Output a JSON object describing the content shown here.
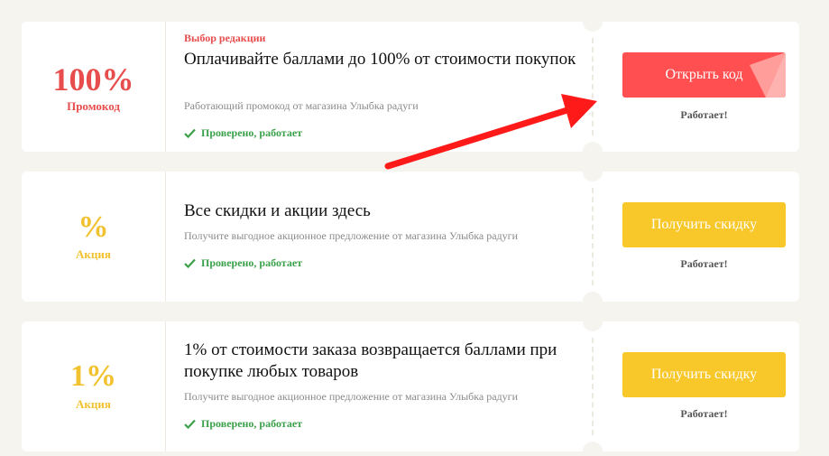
{
  "coupons": [
    {
      "value": "100%",
      "kind": "Промокод",
      "editor_label": "Выбор редакции",
      "title": "Оплачивайте баллами до 100% от стоимости покупок",
      "description": "Работающий промокод от магазина Улыбка радуги",
      "verified": "Проверено, работает",
      "button": "Открыть код",
      "status": "Работает!"
    },
    {
      "value": "%",
      "kind": "Акция",
      "title": "Все скидки и акции здесь",
      "description": "Получите выгодное акционное предложение от магазина Улыбка радуги",
      "verified": "Проверено, работает",
      "button": "Получить скидку",
      "status": "Работает!"
    },
    {
      "value": "1%",
      "kind": "Акция",
      "title": "1% от стоимости заказа возвращается баллами при покупке любых товаров",
      "description": "Получите выгодное акционное предложение от магазина Улыбка радуги",
      "verified": "Проверено, работает",
      "button": "Получить скидку",
      "status": "Работает!"
    }
  ],
  "colors": {
    "promo_red": "#e84d4d",
    "action_yellow": "#f2c12e",
    "verified_green": "#3aa14a",
    "arrow_red": "#ff1a1a"
  }
}
